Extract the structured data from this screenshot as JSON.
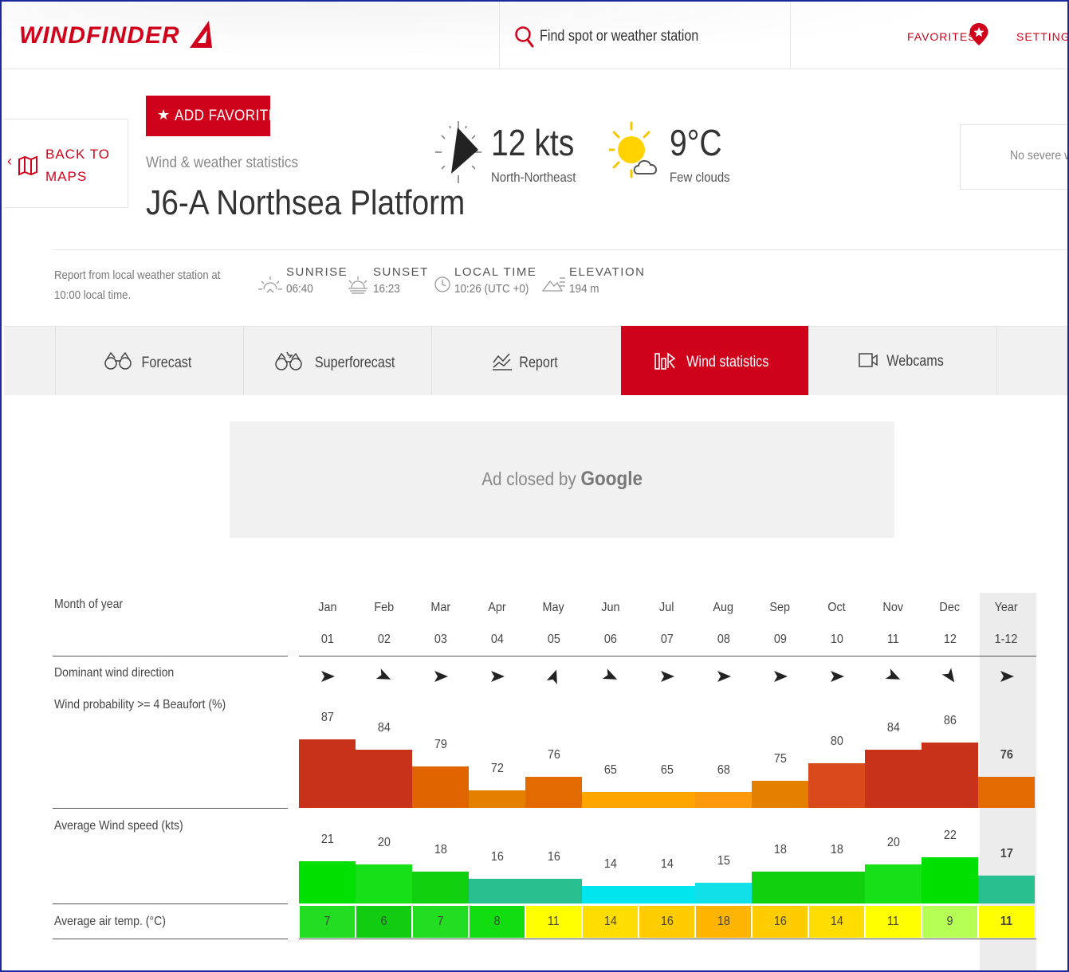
{
  "header": {
    "logo_text": "WINDFINDER",
    "search_placeholder": "Find spot or weather station",
    "favorites_label": "FAVORITES",
    "settings_label": "SETTINGS"
  },
  "spot": {
    "back_label_line1": "BACK TO",
    "back_label_line2": "MAPS",
    "add_favorite_label": "ADD FAVORITE",
    "subtitle": "Wind & weather statistics",
    "name": "J6-A Northsea Platform"
  },
  "current": {
    "wind_speed": "12 kts",
    "wind_direction": "North-Northeast",
    "temperature": "9°C",
    "condition": "Few clouds",
    "warning": "No severe w"
  },
  "info_bar": {
    "report_line1": "Report from local weather station at",
    "report_line2": "10:00 local time.",
    "sunrise_label": "SUNRISE",
    "sunrise_value": "06:40",
    "sunset_label": "SUNSET",
    "sunset_value": "16:23",
    "local_time_label": "LOCAL TIME",
    "local_time_value": "10:26 (UTC +0)",
    "elevation_label": "ELEVATION",
    "elevation_value": "194 m"
  },
  "tabs": [
    {
      "label": "Forecast",
      "icon": "binoculars-icon",
      "active": false
    },
    {
      "label": "Superforecast",
      "icon": "super-binoculars-icon",
      "active": false
    },
    {
      "label": "Report",
      "icon": "report-chart-icon",
      "active": false
    },
    {
      "label": "Wind statistics",
      "icon": "wind-statistics-icon",
      "active": true
    },
    {
      "label": "Webcams",
      "icon": "webcam-icon",
      "active": false
    }
  ],
  "ad": {
    "text": "Ad closed by",
    "brand": "Google"
  },
  "stats": {
    "row_labels": {
      "month": "Month of year",
      "direction": "Dominant wind direction",
      "probability": "Wind probability >= 4 Beaufort  (%)",
      "speed": "Average Wind speed  (kts)",
      "temp": "Average air temp.  (°C)"
    },
    "columns": [
      {
        "name": "Jan",
        "num": "01",
        "dir_deg": 90,
        "prob": 87,
        "prob_color": "#c8321b",
        "speed": 21,
        "speed_color": "#00e000",
        "temp": 7,
        "temp_color": "#22dd22"
      },
      {
        "name": "Feb",
        "num": "02",
        "dir_deg": 115,
        "prob": 84,
        "prob_color": "#c8321b",
        "speed": 20,
        "speed_color": "#18e018",
        "temp": 6,
        "temp_color": "#11cc11"
      },
      {
        "name": "Mar",
        "num": "03",
        "dir_deg": 90,
        "prob": 79,
        "prob_color": "#e06400",
        "speed": 18,
        "speed_color": "#10d010",
        "temp": 7,
        "temp_color": "#22dd22"
      },
      {
        "name": "Apr",
        "num": "04",
        "dir_deg": 90,
        "prob": 72,
        "prob_color": "#e48000",
        "speed": 16,
        "speed_color": "#28c090",
        "temp": 8,
        "temp_color": "#11dd11"
      },
      {
        "name": "May",
        "num": "05",
        "dir_deg": 20,
        "prob": 76,
        "prob_color": "#e26a00",
        "speed": 16,
        "speed_color": "#28c090",
        "temp": 11,
        "temp_color": "#ffff00"
      },
      {
        "name": "Jun",
        "num": "06",
        "dir_deg": 115,
        "prob": 65,
        "prob_color": "#ffa500",
        "speed": 14,
        "speed_color": "#00e6ee",
        "temp": 14,
        "temp_color": "#ffdd00"
      },
      {
        "name": "Jul",
        "num": "07",
        "dir_deg": 90,
        "prob": 65,
        "prob_color": "#ffa500",
        "speed": 14,
        "speed_color": "#00e6ee",
        "temp": 16,
        "temp_color": "#ffcc00"
      },
      {
        "name": "Aug",
        "num": "08",
        "dir_deg": 90,
        "prob": 68,
        "prob_color": "#fb9a0c",
        "speed": 15,
        "speed_color": "#10e0e8",
        "temp": 18,
        "temp_color": "#ffb400"
      },
      {
        "name": "Sep",
        "num": "09",
        "dir_deg": 90,
        "prob": 75,
        "prob_color": "#e48000",
        "speed": 18,
        "speed_color": "#10d010",
        "temp": 16,
        "temp_color": "#ffcc00"
      },
      {
        "name": "Oct",
        "num": "10",
        "dir_deg": 90,
        "prob": 80,
        "prob_color": "#d84a1c",
        "speed": 18,
        "speed_color": "#10d010",
        "temp": 14,
        "temp_color": "#ffdd00"
      },
      {
        "name": "Nov",
        "num": "11",
        "dir_deg": 115,
        "prob": 84,
        "prob_color": "#c8321b",
        "speed": 20,
        "speed_color": "#18e018",
        "temp": 11,
        "temp_color": "#ffff00"
      },
      {
        "name": "Dec",
        "num": "12",
        "dir_deg": 145,
        "prob": 86,
        "prob_color": "#c8321b",
        "speed": 22,
        "speed_color": "#00e000",
        "temp": 9,
        "temp_color": "#b6ff55"
      },
      {
        "name": "Year",
        "num": "1-12",
        "dir_deg": 90,
        "prob": 76,
        "prob_color": "#e26a00",
        "speed": 17,
        "speed_color": "#28c090",
        "temp": 11,
        "temp_color": "#ffff00"
      }
    ]
  },
  "colors": {
    "brand_red": "#d0021b"
  }
}
